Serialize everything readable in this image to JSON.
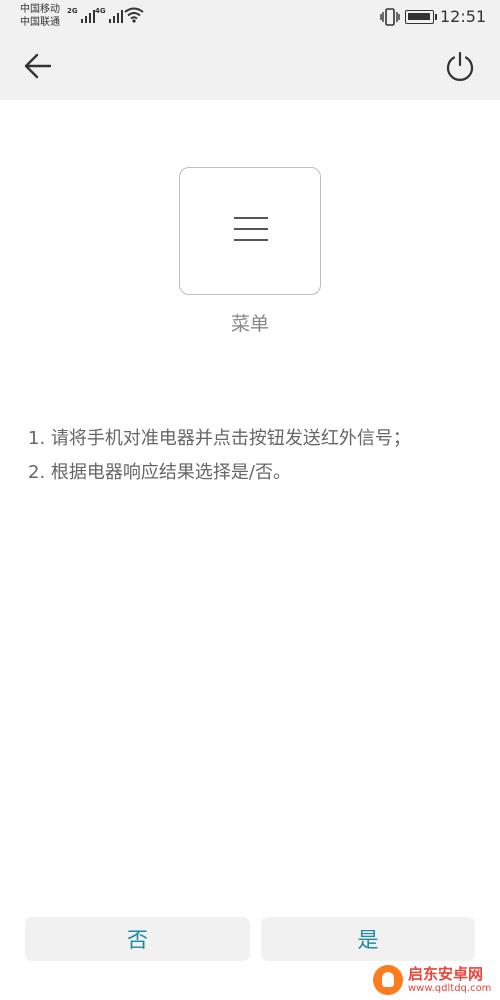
{
  "status_bar": {
    "carrier_1": "中国移动",
    "carrier_2": "中国联通",
    "sim1_network": "2G",
    "sim2_network": "4G",
    "time": "12:51",
    "icons": [
      "signal-icon",
      "wifi-icon",
      "vibrate-icon",
      "battery-charging-icon"
    ]
  },
  "header": {
    "back_icon": "arrow-left-icon",
    "power_icon": "power-icon"
  },
  "remote_key": {
    "icon": "menu-icon",
    "label": "菜单"
  },
  "instructions": [
    "1. 请将手机对准电器并点击按钮发送红外信号；",
    "2. 根据电器响应结果选择是/否。"
  ],
  "actions": {
    "no_label": "否",
    "yes_label": "是"
  },
  "watermark": {
    "name": "启东安卓网",
    "url": "www.qdltdq.com"
  },
  "colors": {
    "accent": "#1b8aa0",
    "header_bg": "#f1f1f1",
    "button_bg": "#f1f1f1"
  }
}
